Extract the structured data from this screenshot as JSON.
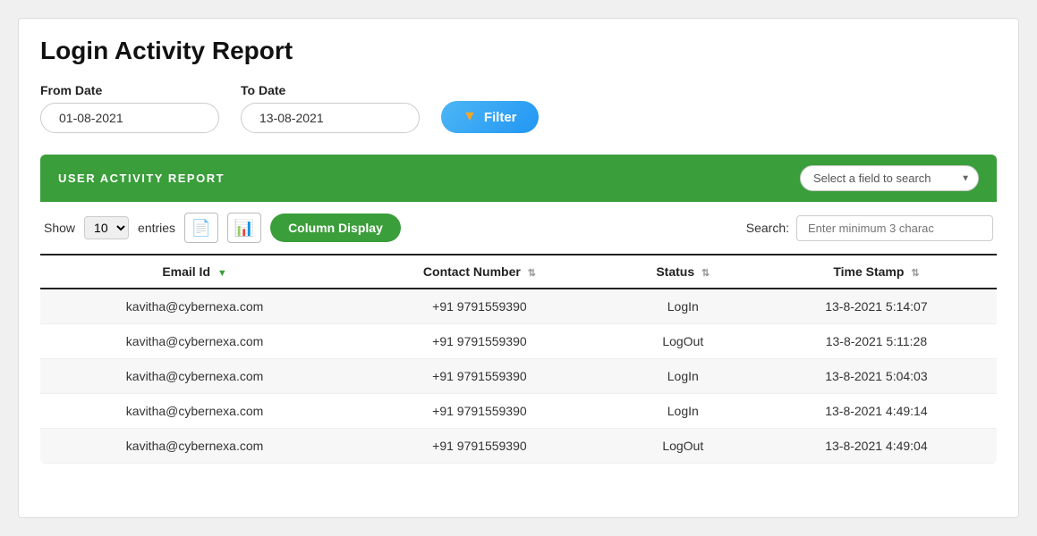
{
  "page": {
    "title": "Login Activity Report"
  },
  "filters": {
    "from_date_label": "From Date",
    "from_date_value": "01-08-2021",
    "to_date_label": "To Date",
    "to_date_value": "13-08-2021",
    "filter_button_label": "Filter"
  },
  "table_section": {
    "header_title": "USER ACTIVITY REPORT",
    "field_search_placeholder": "Select a field to search",
    "show_label": "Show",
    "entries_label": "entries",
    "entries_value": "10",
    "column_display_label": "Column Display",
    "search_label": "Search:",
    "search_placeholder": "Enter minimum 3 charac"
  },
  "columns": [
    {
      "label": "Email Id",
      "sort": "down"
    },
    {
      "label": "Contact Number",
      "sort": "neutral"
    },
    {
      "label": "Status",
      "sort": "neutral"
    },
    {
      "label": "Time Stamp",
      "sort": "neutral"
    }
  ],
  "rows": [
    {
      "email": "kavitha@cybernexa.com",
      "contact": "+91 9791559390",
      "status": "LogIn",
      "timestamp": "13-8-2021 5:14:07"
    },
    {
      "email": "kavitha@cybernexa.com",
      "contact": "+91 9791559390",
      "status": "LogOut",
      "timestamp": "13-8-2021 5:11:28"
    },
    {
      "email": "kavitha@cybernexa.com",
      "contact": "+91 9791559390",
      "status": "LogIn",
      "timestamp": "13-8-2021 5:04:03"
    },
    {
      "email": "kavitha@cybernexa.com",
      "contact": "+91 9791559390",
      "status": "LogIn",
      "timestamp": "13-8-2021 4:49:14"
    },
    {
      "email": "kavitha@cybernexa.com",
      "contact": "+91 9791559390",
      "status": "LogOut",
      "timestamp": "13-8-2021 4:49:04"
    }
  ],
  "icons": {
    "filter": "▼",
    "pdf": "📄",
    "xls": "📊",
    "sort_down": "▼",
    "sort_updown": "⇅"
  }
}
